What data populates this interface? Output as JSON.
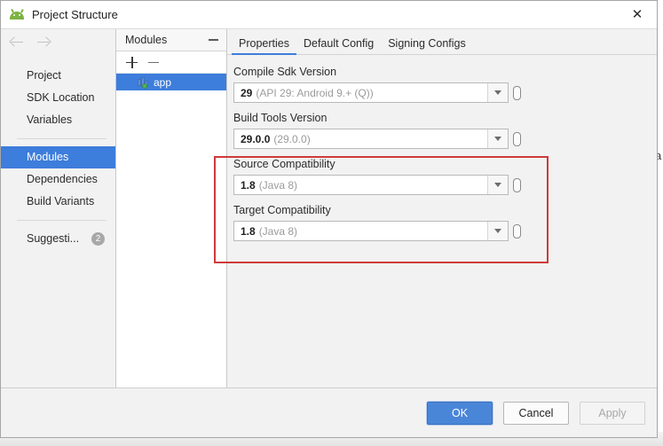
{
  "window": {
    "title": "Project Structure",
    "app_icon": "android-icon",
    "close_label": "✕"
  },
  "behind": {
    "partial_text": "a"
  },
  "leftnav": {
    "back_icon": "arrow-left-icon",
    "forward_icon": "arrow-right-icon",
    "groups": [
      {
        "items": [
          {
            "label": "Project",
            "selected": false
          },
          {
            "label": "SDK Location",
            "selected": false
          },
          {
            "label": "Variables",
            "selected": false
          }
        ]
      },
      {
        "items": [
          {
            "label": "Modules",
            "selected": true
          },
          {
            "label": "Dependencies",
            "selected": false
          },
          {
            "label": "Build Variants",
            "selected": false
          }
        ]
      },
      {
        "items": [
          {
            "label": "Suggesti...",
            "selected": false,
            "badge": "2"
          }
        ]
      }
    ]
  },
  "modules_panel": {
    "header": "Modules",
    "hide_icon": "minimize-icon",
    "add_icon": "plus-icon",
    "remove_icon": "minus-icon",
    "items": [
      {
        "label": "app",
        "icon": "module-icon",
        "selected": true
      }
    ]
  },
  "properties": {
    "tabs": [
      {
        "label": "Properties",
        "active": true
      },
      {
        "label": "Default Config",
        "active": false
      },
      {
        "label": "Signing Configs",
        "active": false
      }
    ],
    "fields": [
      {
        "label": "Compile Sdk Version",
        "value": "29",
        "hint": "(API 29: Android 9.+ (Q))",
        "dropdown_icon": "chevron-down-icon",
        "variable_icon": "variable-button-icon"
      },
      {
        "label": "Build Tools Version",
        "value": "29.0.0",
        "hint": "(29.0.0)",
        "dropdown_icon": "chevron-down-icon",
        "variable_icon": "variable-button-icon"
      },
      {
        "label": "Source Compatibility",
        "value": "1.8",
        "hint": "(Java 8)",
        "dropdown_icon": "chevron-down-icon",
        "variable_icon": "variable-button-icon"
      },
      {
        "label": "Target Compatibility",
        "value": "1.8",
        "hint": "(Java 8)",
        "dropdown_icon": "chevron-down-icon",
        "variable_icon": "variable-button-icon"
      }
    ],
    "highlight_color": "#cf3a3a"
  },
  "footer": {
    "ok": "OK",
    "cancel": "Cancel",
    "apply": "Apply"
  },
  "colors": {
    "accent": "#3d7ddb",
    "primary_button": "#4a86d8",
    "highlight": "#cf3a3a",
    "android_green": "#7cb342"
  }
}
